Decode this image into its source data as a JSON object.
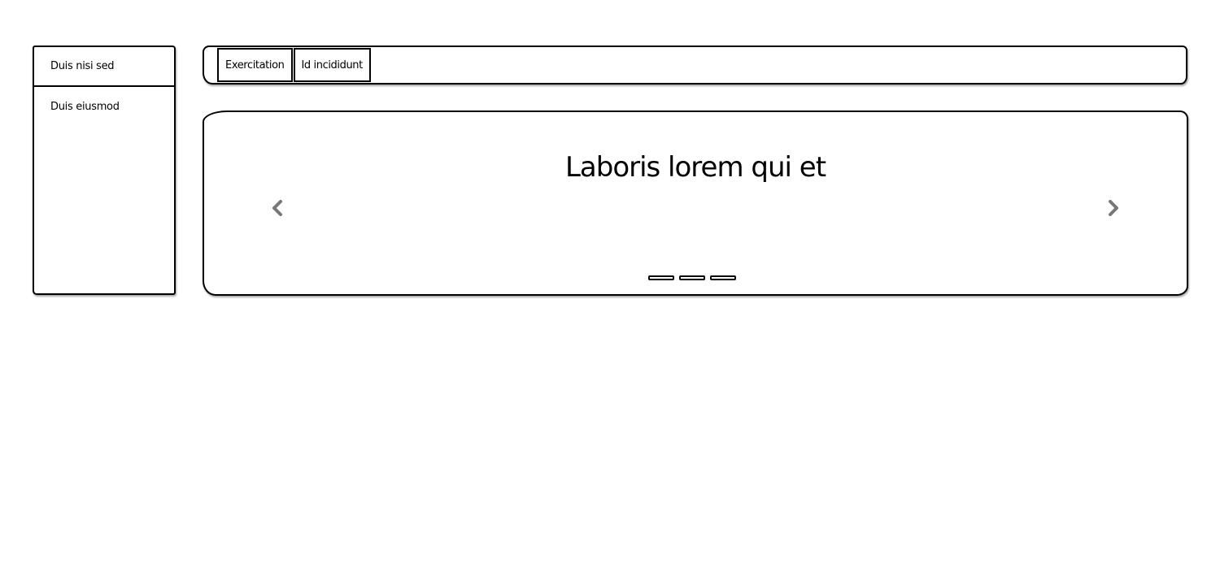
{
  "sidebar": {
    "items": [
      {
        "label": "Duis nisi sed"
      },
      {
        "label": "Duis eiusmod"
      }
    ]
  },
  "tabs": [
    {
      "label": "Exercitation"
    },
    {
      "label": "Id incididunt"
    }
  ],
  "carousel": {
    "title": "Laboris lorem qui et",
    "prev_icon": "chevron-left-icon",
    "next_icon": "chevron-right-icon",
    "arrow_color": "#777777",
    "slide_count": 3
  }
}
